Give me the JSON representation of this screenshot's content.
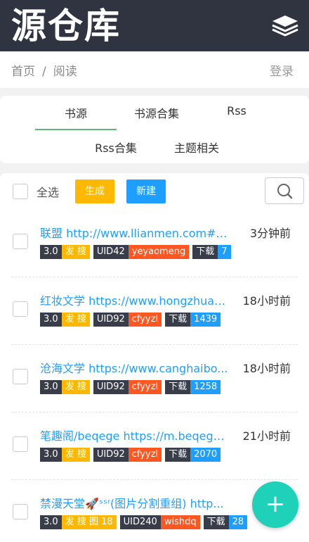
{
  "header": {
    "title": "源仓库",
    "menu_icon": "layers-icon"
  },
  "breadcrumb": {
    "home": "首页",
    "separator": "/",
    "current": "阅读"
  },
  "login_label": "登录",
  "tabs": [
    {
      "label": "书源",
      "active": true
    },
    {
      "label": "书源合集"
    },
    {
      "label": "Rss"
    },
    {
      "label": "Rss合集"
    },
    {
      "label": "主题相关"
    }
  ],
  "toolbar": {
    "select_all": "全选",
    "generate": "生成",
    "new": "新建",
    "search_icon": "search-icon"
  },
  "items": [
    {
      "name": "联盟 http://www.llianmen.com##...",
      "time": "3分钟前",
      "version": "3.0",
      "tags": "发 搜",
      "uid": "UID42",
      "user": "yeyaomeng",
      "download_label": "下载",
      "downloads": "7"
    },
    {
      "name": "红妆文学 https://www.hongzhuan...",
      "time": "18小时前",
      "version": "3.0",
      "tags": "发 搜",
      "uid": "UID92",
      "user": "cfyyzl",
      "download_label": "下载",
      "downloads": "1439"
    },
    {
      "name": "沧海文学 https://www.canghaibo...",
      "time": "18小时前",
      "version": "3.0",
      "tags": "发 搜",
      "uid": "UID92",
      "user": "cfyyzl",
      "download_label": "下载",
      "downloads": "1258"
    },
    {
      "name": "笔趣阁/beqege https://m.beqege....",
      "time": "21小时前",
      "version": "3.0",
      "tags": "发 搜",
      "uid": "UID92",
      "user": "cfyyzl",
      "download_label": "下载",
      "downloads": "2070"
    },
    {
      "name": "禁漫天堂🚀ˢˢʳ(图片分割重组) http...",
      "time": "",
      "version": "3.0",
      "tags": "发 搜 图 18",
      "uid": "UID240",
      "user": "wishdq",
      "download_label": "下载",
      "downloads": "28"
    }
  ],
  "fab": {
    "label": "+"
  },
  "colors": {
    "header_bg": "#2f3440",
    "accent_green": "#5fb878",
    "link_blue": "#1e9fff",
    "tag_yellow": "#ffb800",
    "tag_red": "#ff5722",
    "tag_dark": "#393d49",
    "fab": "#1fd1b9"
  }
}
